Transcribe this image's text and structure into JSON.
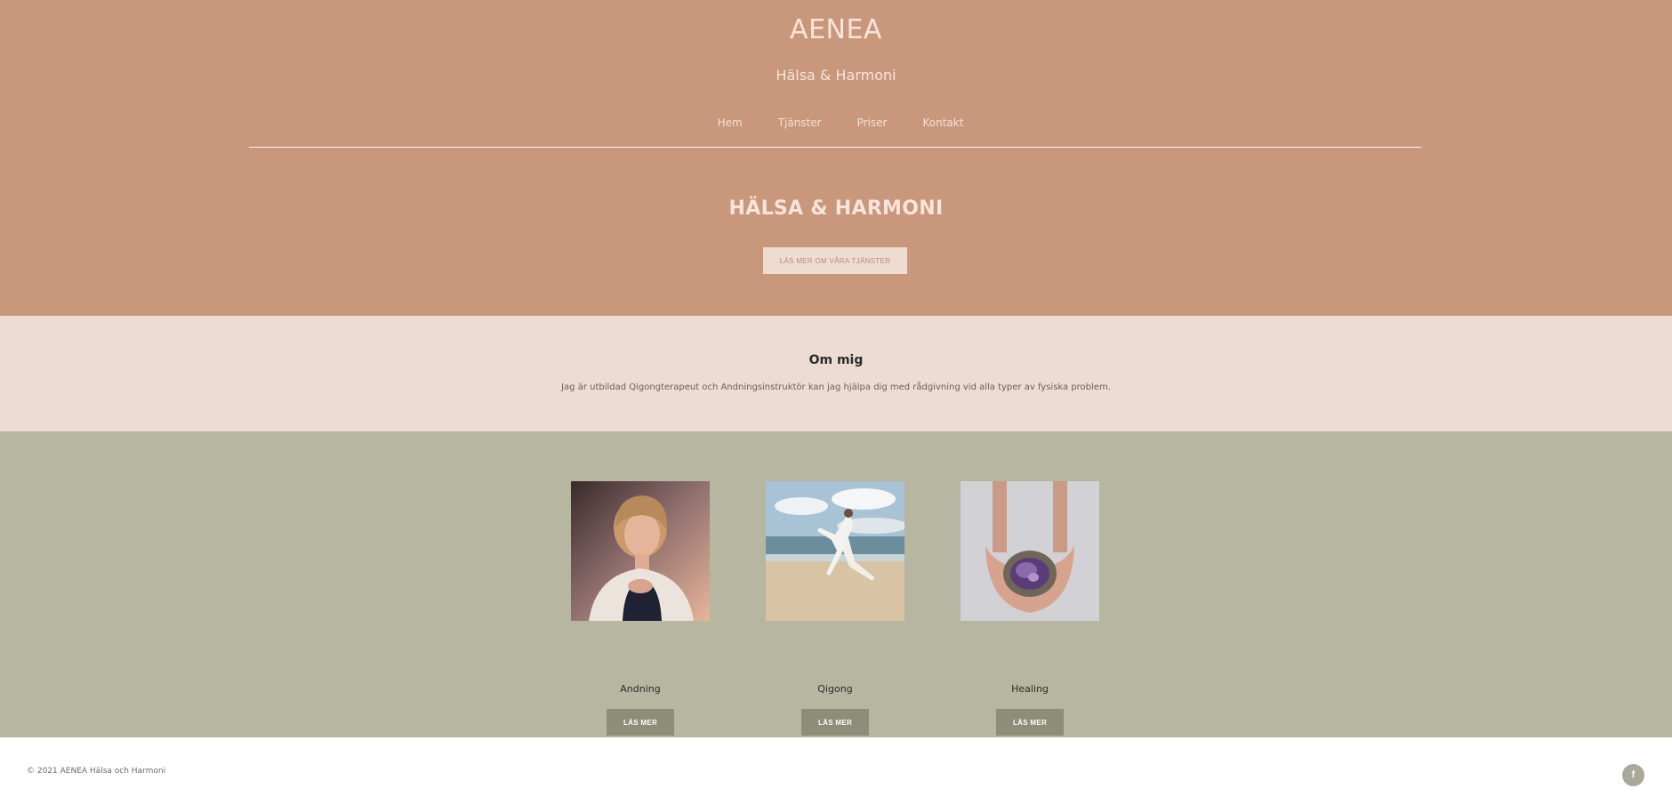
{
  "header": {
    "brand": "AENEA",
    "tagline": "Hälsa & Harmoni",
    "nav": [
      "Hem",
      "Tjänster",
      "Priser",
      "Kontakt"
    ]
  },
  "hero": {
    "title": "HÄLSA & HARMONI",
    "button_label": "LÄS MER OM VÅRA TJÄNSTER"
  },
  "about": {
    "title": "Om mig",
    "text": "Jag är utbildad Qigongterapeut och Andningsinstruktör kan jag hjälpa dig med rådgivning vid alla typer av fysiska problem."
  },
  "services": [
    {
      "label": "Andning",
      "button_label": "LÄS MER",
      "image": "woman-breathing-photo"
    },
    {
      "label": "Qigong",
      "button_label": "LÄS MER",
      "image": "qigong-beach-photo"
    },
    {
      "label": "Healing",
      "button_label": "LÄS MER",
      "image": "hands-amethyst-photo"
    }
  ],
  "footer": {
    "copyright": "© 2021 AENEA Hälsa och Harmoni",
    "social_icon": "facebook-icon"
  },
  "colors": {
    "hero_bg": "#c9977c",
    "about_bg": "#ecdcd3",
    "services_bg": "#b7b6a1",
    "service_button": "#8e8d78"
  }
}
